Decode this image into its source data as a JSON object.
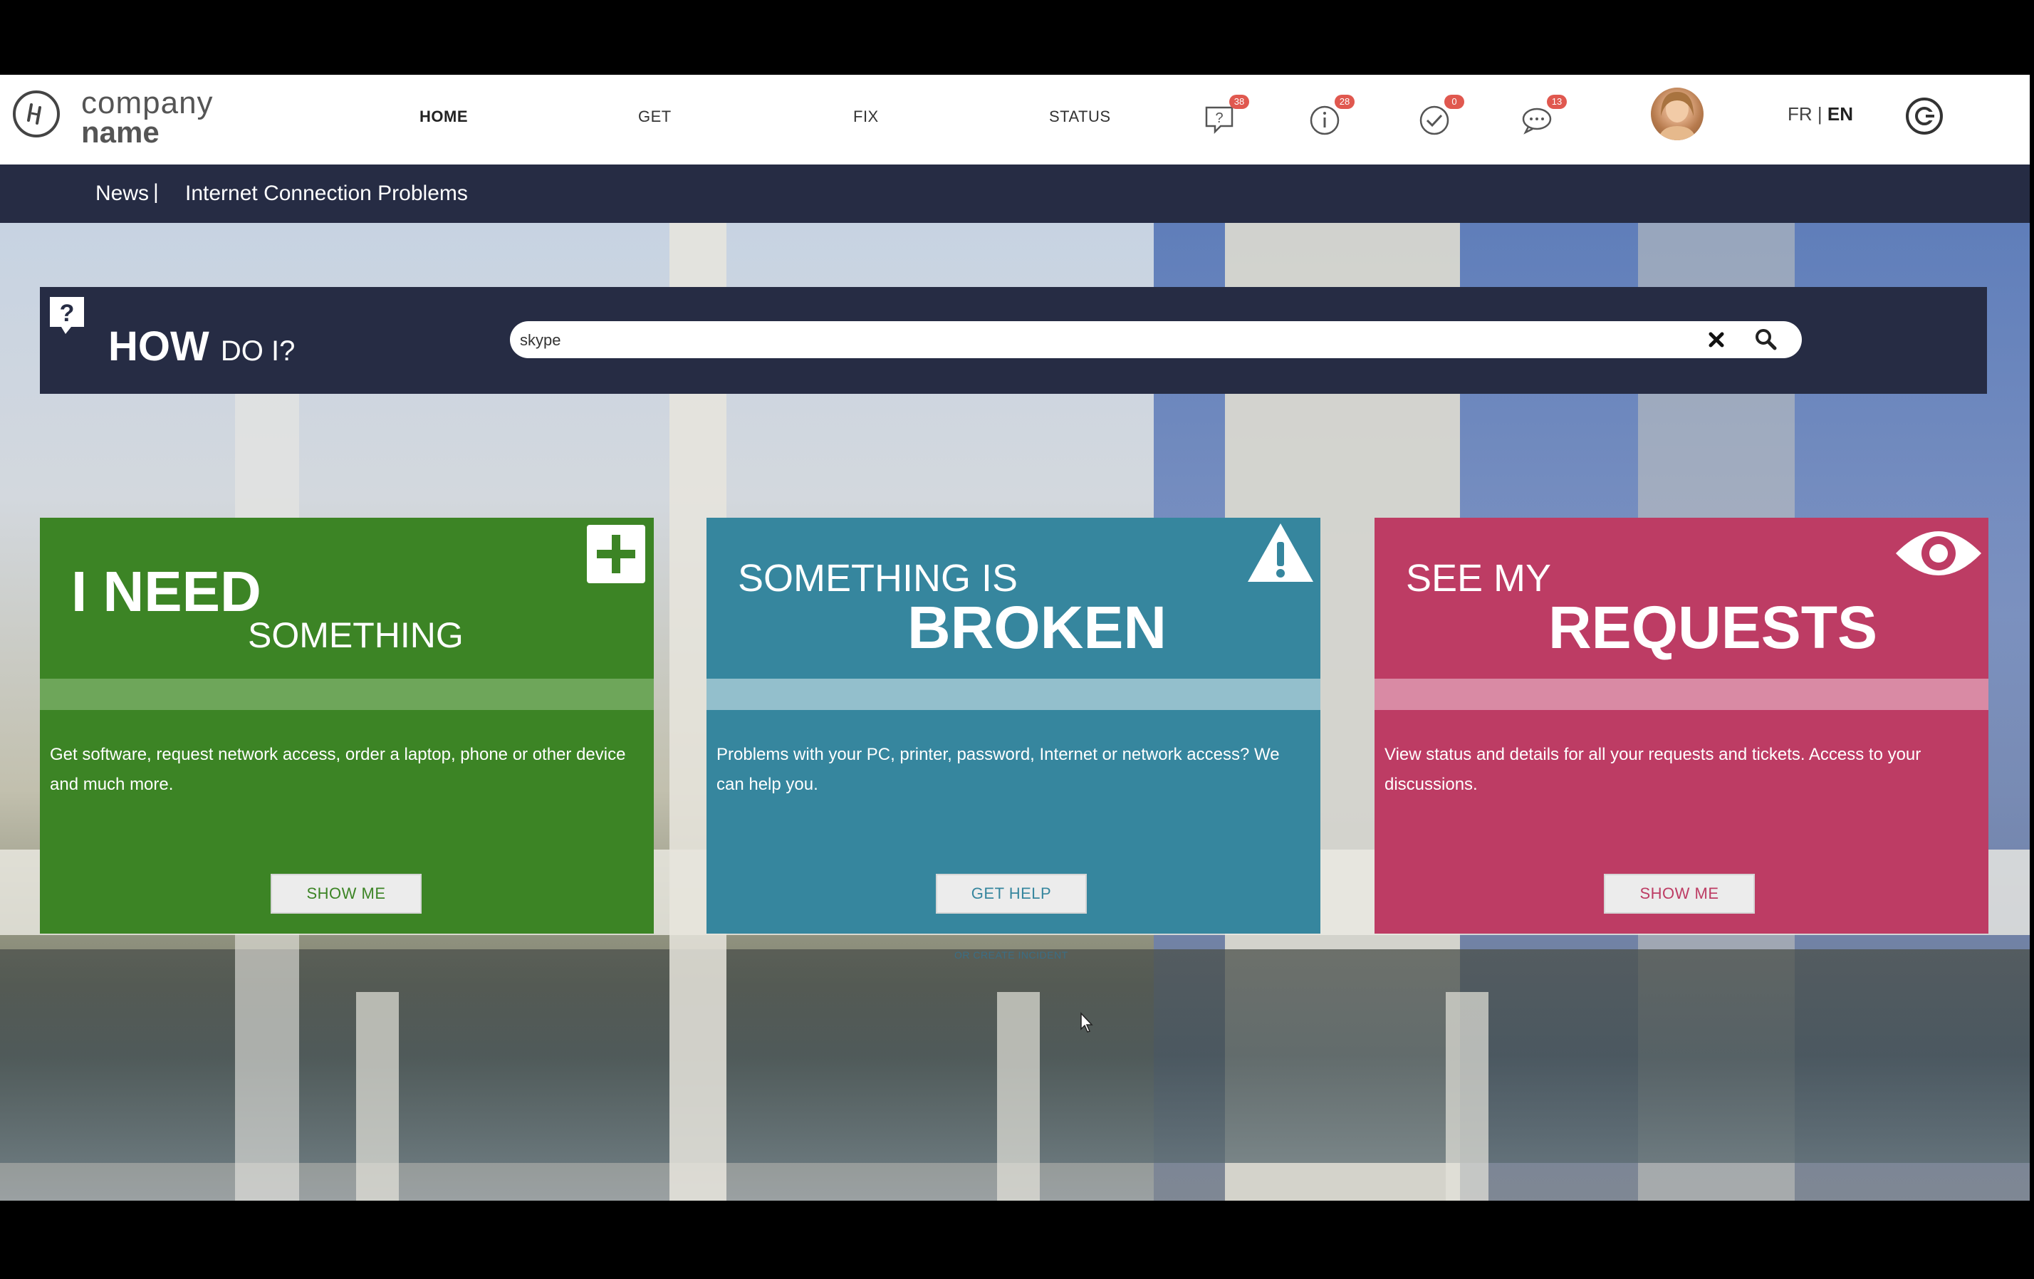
{
  "header": {
    "logo": {
      "line1": "company",
      "line2": "name"
    },
    "nav": [
      {
        "label": "HOME",
        "active": true
      },
      {
        "label": "GET",
        "active": false
      },
      {
        "label": "FIX",
        "active": false
      },
      {
        "label": "STATUS",
        "active": false
      }
    ],
    "icons": [
      {
        "name": "help-chat-icon",
        "badge": "38"
      },
      {
        "name": "info-icon",
        "badge": "28"
      },
      {
        "name": "approval-check-icon",
        "badge": "0"
      },
      {
        "name": "discussion-icon",
        "badge": "13"
      }
    ],
    "language": {
      "fr": "FR",
      "sep": "|",
      "en": "EN",
      "active": "EN"
    }
  },
  "news": {
    "label": "News",
    "separator": "|",
    "headline": "Internet Connection Problems"
  },
  "how_do_i": {
    "title_big": "HOW",
    "title_small": "DO I?",
    "search_value": "skype"
  },
  "cards": [
    {
      "title_line1": "I NEED",
      "title_line2": "SOMETHING",
      "description": "Get software, request network access, order a laptop, phone or other device and much more.",
      "button": "SHOW ME",
      "icon": "plus-icon",
      "color": "#3c8425"
    },
    {
      "title_line1": "SOMETHING IS",
      "title_line2": "BROKEN",
      "description": "Problems with your PC, printer, password, Internet or network access? We can help you.",
      "button": "GET HELP",
      "icon": "warning-icon",
      "color": "#36869e",
      "sub_link": "OR CREATE INCIDENT"
    },
    {
      "title_line1": "SEE MY",
      "title_line2": "REQUESTS",
      "description": "View status and details for all your requests and tickets. Access to your discussions.",
      "button": "SHOW ME",
      "icon": "eye-icon",
      "color": "#bd3c64"
    }
  ],
  "colors": {
    "navy": "#262c44",
    "green": "#3c8425",
    "blue": "#36869e",
    "pink": "#bd3c64",
    "badge": "#e0584f"
  }
}
